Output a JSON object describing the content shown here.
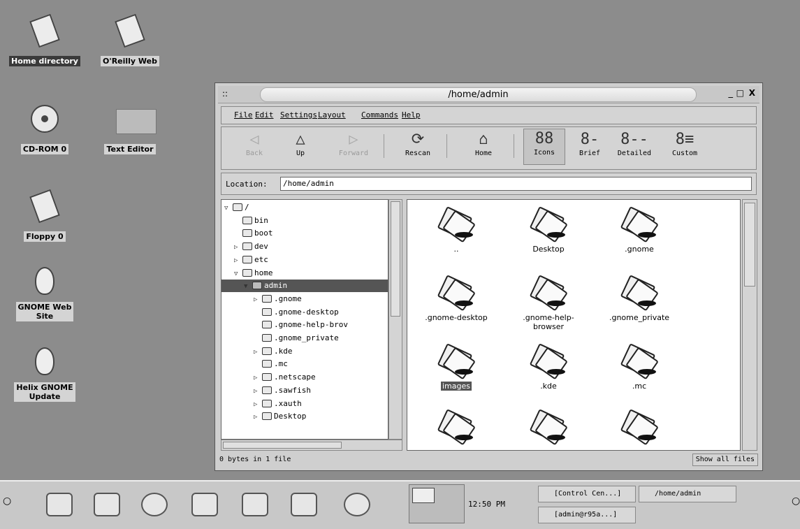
{
  "desktop": {
    "icons": [
      {
        "label": "Home directory",
        "selected": true
      },
      {
        "label": "O'Reilly Web",
        "selected": false
      },
      {
        "label": "CD-ROM 0",
        "selected": false
      },
      {
        "label": "Text Editor",
        "selected": false
      },
      {
        "label": "Floppy 0",
        "selected": false
      },
      {
        "label": "GNOME Web",
        "label2": "Site",
        "selected": false
      },
      {
        "label": "Helix GNOME",
        "label2": "Update",
        "selected": false
      }
    ]
  },
  "window": {
    "title": "/home/admin",
    "controls": [
      "_",
      "□",
      "X"
    ],
    "menu": [
      "File",
      "Edit",
      "Settings",
      "Layout",
      "Commands",
      "Help"
    ],
    "toolbar": [
      {
        "label": "Back",
        "icon": "back-arrow-icon",
        "glyph": "◁",
        "enabled": false
      },
      {
        "label": "Up",
        "icon": "up-arrow-icon",
        "glyph": "△",
        "enabled": true
      },
      {
        "label": "Forward",
        "icon": "forward-arrow-icon",
        "glyph": "▷",
        "enabled": false
      },
      {
        "label": "Rescan",
        "icon": "rescan-icon",
        "glyph": "⟳",
        "enabled": true
      },
      {
        "label": "Home",
        "icon": "home-icon",
        "glyph": "⌂",
        "enabled": true
      },
      {
        "label": "Icons",
        "icon": "icons-view-icon",
        "glyph": "88",
        "enabled": true,
        "active": true
      },
      {
        "label": "Brief",
        "icon": "brief-view-icon",
        "glyph": "8-",
        "enabled": true
      },
      {
        "label": "Detailed",
        "icon": "detailed-view-icon",
        "glyph": "8--",
        "enabled": true
      },
      {
        "label": "Custom",
        "icon": "custom-view-icon",
        "glyph": "8≡",
        "enabled": true
      }
    ],
    "location": {
      "label": "Location:",
      "value": "/home/admin"
    },
    "tree": [
      {
        "name": "/",
        "expander": "▽",
        "depth": 0
      },
      {
        "name": "bin",
        "expander": "",
        "depth": 1
      },
      {
        "name": "boot",
        "expander": "",
        "depth": 1
      },
      {
        "name": "dev",
        "expander": "▷",
        "depth": 1
      },
      {
        "name": "etc",
        "expander": "▷",
        "depth": 1
      },
      {
        "name": "home",
        "expander": "▽",
        "depth": 1
      },
      {
        "name": "admin",
        "expander": "▼",
        "depth": 2,
        "selected": true
      },
      {
        "name": ".gnome",
        "expander": "▷",
        "depth": 3
      },
      {
        "name": ".gnome-desktop",
        "expander": "",
        "depth": 3
      },
      {
        "name": ".gnome-help-brov",
        "expander": "",
        "depth": 3
      },
      {
        "name": ".gnome_private",
        "expander": "",
        "depth": 3
      },
      {
        "name": ".kde",
        "expander": "▷",
        "depth": 3
      },
      {
        "name": ".mc",
        "expander": "",
        "depth": 3
      },
      {
        "name": ".netscape",
        "expander": "▷",
        "depth": 3
      },
      {
        "name": ".sawfish",
        "expander": "▷",
        "depth": 3
      },
      {
        "name": ".xauth",
        "expander": "▷",
        "depth": 3
      },
      {
        "name": "Desktop",
        "expander": "▷",
        "depth": 3
      }
    ],
    "files": [
      {
        "name": "..",
        "selected": false
      },
      {
        "name": "Desktop",
        "selected": false
      },
      {
        "name": ".gnome",
        "selected": false
      },
      {
        "name": ".gnome-desktop",
        "selected": false
      },
      {
        "name": ".gnome-help-browser",
        "selected": false
      },
      {
        "name": ".gnome_private",
        "selected": false
      },
      {
        "name": "images",
        "selected": true
      },
      {
        "name": ".kde",
        "selected": false
      },
      {
        "name": ".mc",
        "selected": false
      },
      {
        "name": "",
        "selected": false
      },
      {
        "name": "",
        "selected": false
      },
      {
        "name": "",
        "selected": false
      }
    ],
    "status": {
      "left": "0 bytes in 1 file",
      "right": "Show all files"
    }
  },
  "panel": {
    "launchers": [
      "gnome-foot-icon",
      "monitor-icon",
      "help-icon",
      "terminal-shell-icon",
      "text-editor-icon",
      "house-icon",
      "globe-icon"
    ],
    "clock": "12:50 PM",
    "tasks": [
      {
        "label": "[Control Cen...]"
      },
      {
        "label": "[admin@r95a...]"
      },
      {
        "label": "/home/admin"
      }
    ]
  }
}
